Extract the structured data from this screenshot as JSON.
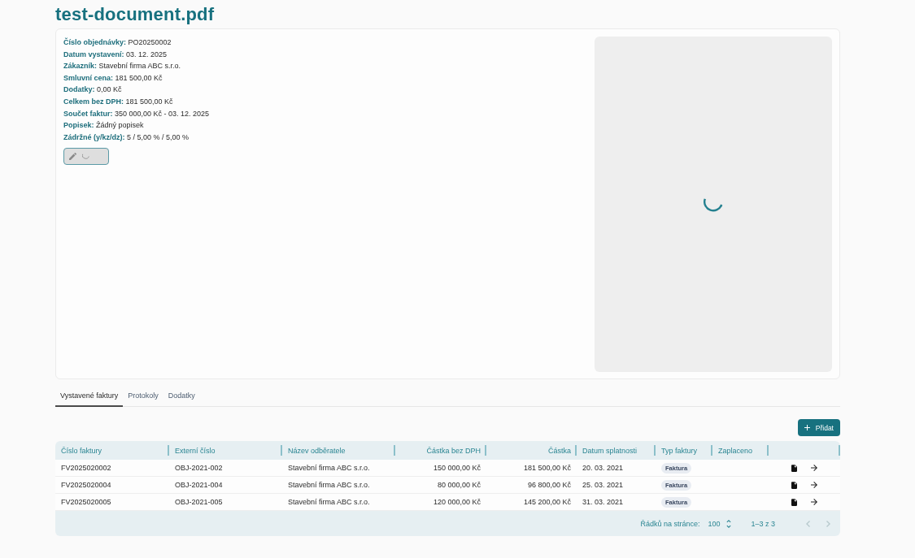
{
  "page": {
    "title": "test-document.pdf"
  },
  "details": {
    "fields": [
      {
        "label": "Číslo objednávky:",
        "value": "PO20250002"
      },
      {
        "label": "Datum vystavení:",
        "value": "03. 12. 2025"
      },
      {
        "label": "Zákazník:",
        "value": "Stavební firma ABC s.r.o."
      },
      {
        "label": "Smluvní cena:",
        "value": "181 500,00 Kč"
      },
      {
        "label": "Dodatky:",
        "value": "0,00 Kč"
      },
      {
        "label": "Celkem bez DPH:",
        "value": "181 500,00 Kč"
      },
      {
        "label": "Součet faktur:",
        "value": "350 000,00 Kč - 03. 12. 2025"
      },
      {
        "label": "Popisek:",
        "value": "Žádný popisek"
      },
      {
        "label": "Zádržné (y/kz/dz):",
        "value": "5 / 5,00 % / 5,00 %"
      }
    ],
    "edit_button": {
      "disabled": true,
      "loading": true
    }
  },
  "preview": {
    "loading": true
  },
  "tabs": [
    {
      "label": "Vystavené faktury",
      "selected": true
    },
    {
      "label": "Protokoly",
      "selected": false
    },
    {
      "label": "Dodatky",
      "selected": false
    }
  ],
  "add_button": {
    "label": "Přidat"
  },
  "table": {
    "columns": [
      {
        "label": "Číslo faktury",
        "kind": "text"
      },
      {
        "label": "Externí číslo",
        "kind": "text"
      },
      {
        "label": "Název odběratele",
        "kind": "text"
      },
      {
        "label": "Částka bez DPH",
        "kind": "amount"
      },
      {
        "label": "Částka",
        "kind": "amount"
      },
      {
        "label": "Datum splatnosti",
        "kind": "text"
      },
      {
        "label": "Typ faktury",
        "kind": "badge"
      },
      {
        "label": "Zaplaceno",
        "kind": "text"
      }
    ],
    "rows": [
      {
        "cells": [
          "FV2025020002",
          "OBJ-2021-002",
          "Stavební firma ABC s.r.o.",
          "150 000,00 Kč",
          "181 500,00 Kč",
          "20. 03. 2021",
          "Faktura"
        ]
      },
      {
        "cells": [
          "FV2025020004",
          "OBJ-2021-004",
          "Stavební firma ABC s.r.o.",
          "80 000,00 Kč",
          "96 800,00 Kč",
          "25. 03. 2021",
          "Faktura"
        ]
      },
      {
        "cells": [
          "FV2025020005",
          "OBJ-2021-005",
          "Stavební firma ABC s.r.o.",
          "120 000,00 Kč",
          "145 200,00 Kč",
          "31. 03. 2021",
          "Faktura"
        ]
      }
    ],
    "pagination": {
      "rows_per_page_label": "Řádků na stránce:",
      "rows_per_page": "100",
      "range": "1–3 z 3",
      "prev_disabled": true,
      "next_disabled": true
    }
  }
}
